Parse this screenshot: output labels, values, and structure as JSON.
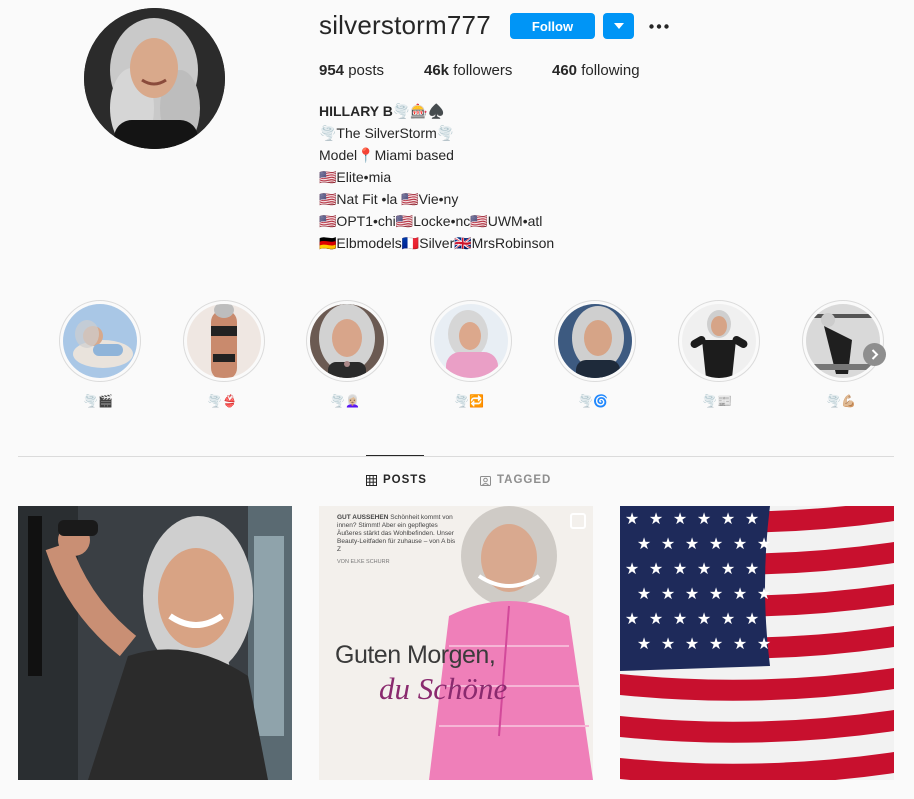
{
  "profile": {
    "username": "silverstorm777",
    "follow_label": "Follow"
  },
  "stats": {
    "posts_count": "954",
    "posts_label": "posts",
    "followers_count": "46k",
    "followers_label": "followers",
    "following_count": "460",
    "following_label": "following"
  },
  "bio": {
    "name": "HILLARY B🌪️🎰♠️",
    "lines": [
      "🌪️The SilverStorm🌪️",
      "Model📍Miami based",
      "🇺🇸Elite•mia",
      "🇺🇸Nat Fit •la 🇺🇸Vie•ny",
      "🇺🇸OPT1•chi🇺🇸Locke•nc🇺🇸UWM•atl",
      "🇩🇪Elbmodels🇫🇷Silver🇬🇧MrsRobinson"
    ]
  },
  "highlights": [
    {
      "label": "🌪️🎬"
    },
    {
      "label": "🌪️👙"
    },
    {
      "label": "🌪️👩🏼‍🦳"
    },
    {
      "label": "🌪️🔁"
    },
    {
      "label": "🌪️🌀"
    },
    {
      "label": "🌪️📰"
    },
    {
      "label": "🌪️💪🏼"
    }
  ],
  "tabs": {
    "posts": "POSTS",
    "tagged": "TAGGED"
  },
  "posts": {
    "magazine_kicker_bold": "GUT AUSSEHEN",
    "magazine_kicker": "Schönheit kommt von innen? Stimmt! Aber ein gepflegtes Äußeres stärkt das Wohlbefinden. Unser Beauty-Leitfaden für zuhause – von A bis Z",
    "magazine_byline": "VON ELKE SCHURR",
    "magazine_headline_1": "Guten Morgen,",
    "magazine_headline_2": "du Schöne"
  },
  "colors": {
    "accent": "#0095f6",
    "text": "#262626",
    "muted": "#8e8e8e",
    "background": "#fafafa",
    "border": "#dbdbdb",
    "magazine_pink": "#8a2a6e"
  }
}
